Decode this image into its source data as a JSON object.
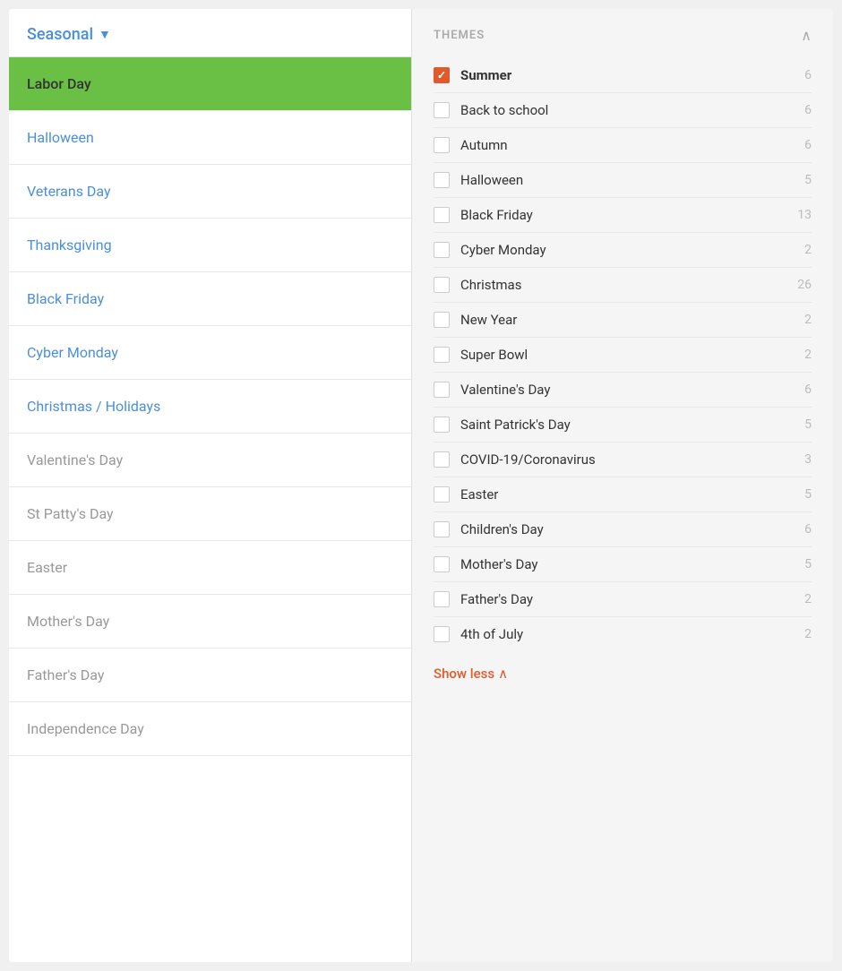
{
  "left": {
    "header": {
      "label": "Seasonal",
      "dropdown_arrow": "▼"
    },
    "items": [
      {
        "id": "labor-day",
        "label": "Labor Day",
        "style": "active"
      },
      {
        "id": "halloween",
        "label": "Halloween",
        "style": "blue"
      },
      {
        "id": "veterans-day",
        "label": "Veterans Day",
        "style": "blue"
      },
      {
        "id": "thanksgiving",
        "label": "Thanksgiving",
        "style": "blue"
      },
      {
        "id": "black-friday",
        "label": "Black Friday",
        "style": "blue"
      },
      {
        "id": "cyber-monday",
        "label": "Cyber Monday",
        "style": "blue"
      },
      {
        "id": "christmas-holidays",
        "label": "Christmas / Holidays",
        "style": "blue"
      },
      {
        "id": "valentines-day",
        "label": "Valentine's Day",
        "style": "gray"
      },
      {
        "id": "st-pattys-day",
        "label": "St Patty's Day",
        "style": "gray"
      },
      {
        "id": "easter",
        "label": "Easter",
        "style": "gray"
      },
      {
        "id": "mothers-day",
        "label": "Mother's Day",
        "style": "gray"
      },
      {
        "id": "fathers-day",
        "label": "Father's Day",
        "style": "gray"
      },
      {
        "id": "independence-day",
        "label": "Independence Day",
        "style": "gray"
      }
    ]
  },
  "right": {
    "themes_title": "THEMES",
    "collapse_icon": "∧",
    "items": [
      {
        "id": "summer",
        "label": "Summer",
        "count": "6",
        "checked": true,
        "bold": true
      },
      {
        "id": "back-to-school",
        "label": "Back to school",
        "count": "6",
        "checked": false,
        "bold": false
      },
      {
        "id": "autumn",
        "label": "Autumn",
        "count": "6",
        "checked": false,
        "bold": false
      },
      {
        "id": "halloween",
        "label": "Halloween",
        "count": "5",
        "checked": false,
        "bold": false
      },
      {
        "id": "black-friday",
        "label": "Black Friday",
        "count": "13",
        "checked": false,
        "bold": false
      },
      {
        "id": "cyber-monday",
        "label": "Cyber Monday",
        "count": "2",
        "checked": false,
        "bold": false
      },
      {
        "id": "christmas",
        "label": "Christmas",
        "count": "26",
        "checked": false,
        "bold": false
      },
      {
        "id": "new-year",
        "label": "New Year",
        "count": "2",
        "checked": false,
        "bold": false
      },
      {
        "id": "super-bowl",
        "label": "Super Bowl",
        "count": "2",
        "checked": false,
        "bold": false
      },
      {
        "id": "valentines-day",
        "label": "Valentine's Day",
        "count": "6",
        "checked": false,
        "bold": false
      },
      {
        "id": "saint-patricks",
        "label": "Saint Patrick's Day",
        "count": "5",
        "checked": false,
        "bold": false
      },
      {
        "id": "covid",
        "label": "COVID-19/Coronavirus",
        "count": "3",
        "checked": false,
        "bold": false
      },
      {
        "id": "easter",
        "label": "Easter",
        "count": "5",
        "checked": false,
        "bold": false
      },
      {
        "id": "childrens-day",
        "label": "Children's Day",
        "count": "6",
        "checked": false,
        "bold": false
      },
      {
        "id": "mothers-day",
        "label": "Mother's Day",
        "count": "5",
        "checked": false,
        "bold": false
      },
      {
        "id": "fathers-day",
        "label": "Father's Day",
        "count": "2",
        "checked": false,
        "bold": false
      },
      {
        "id": "4th-of-july",
        "label": "4th of July",
        "count": "2",
        "checked": false,
        "bold": false
      }
    ],
    "show_less_label": "Show less",
    "show_less_arrow": "∧"
  }
}
